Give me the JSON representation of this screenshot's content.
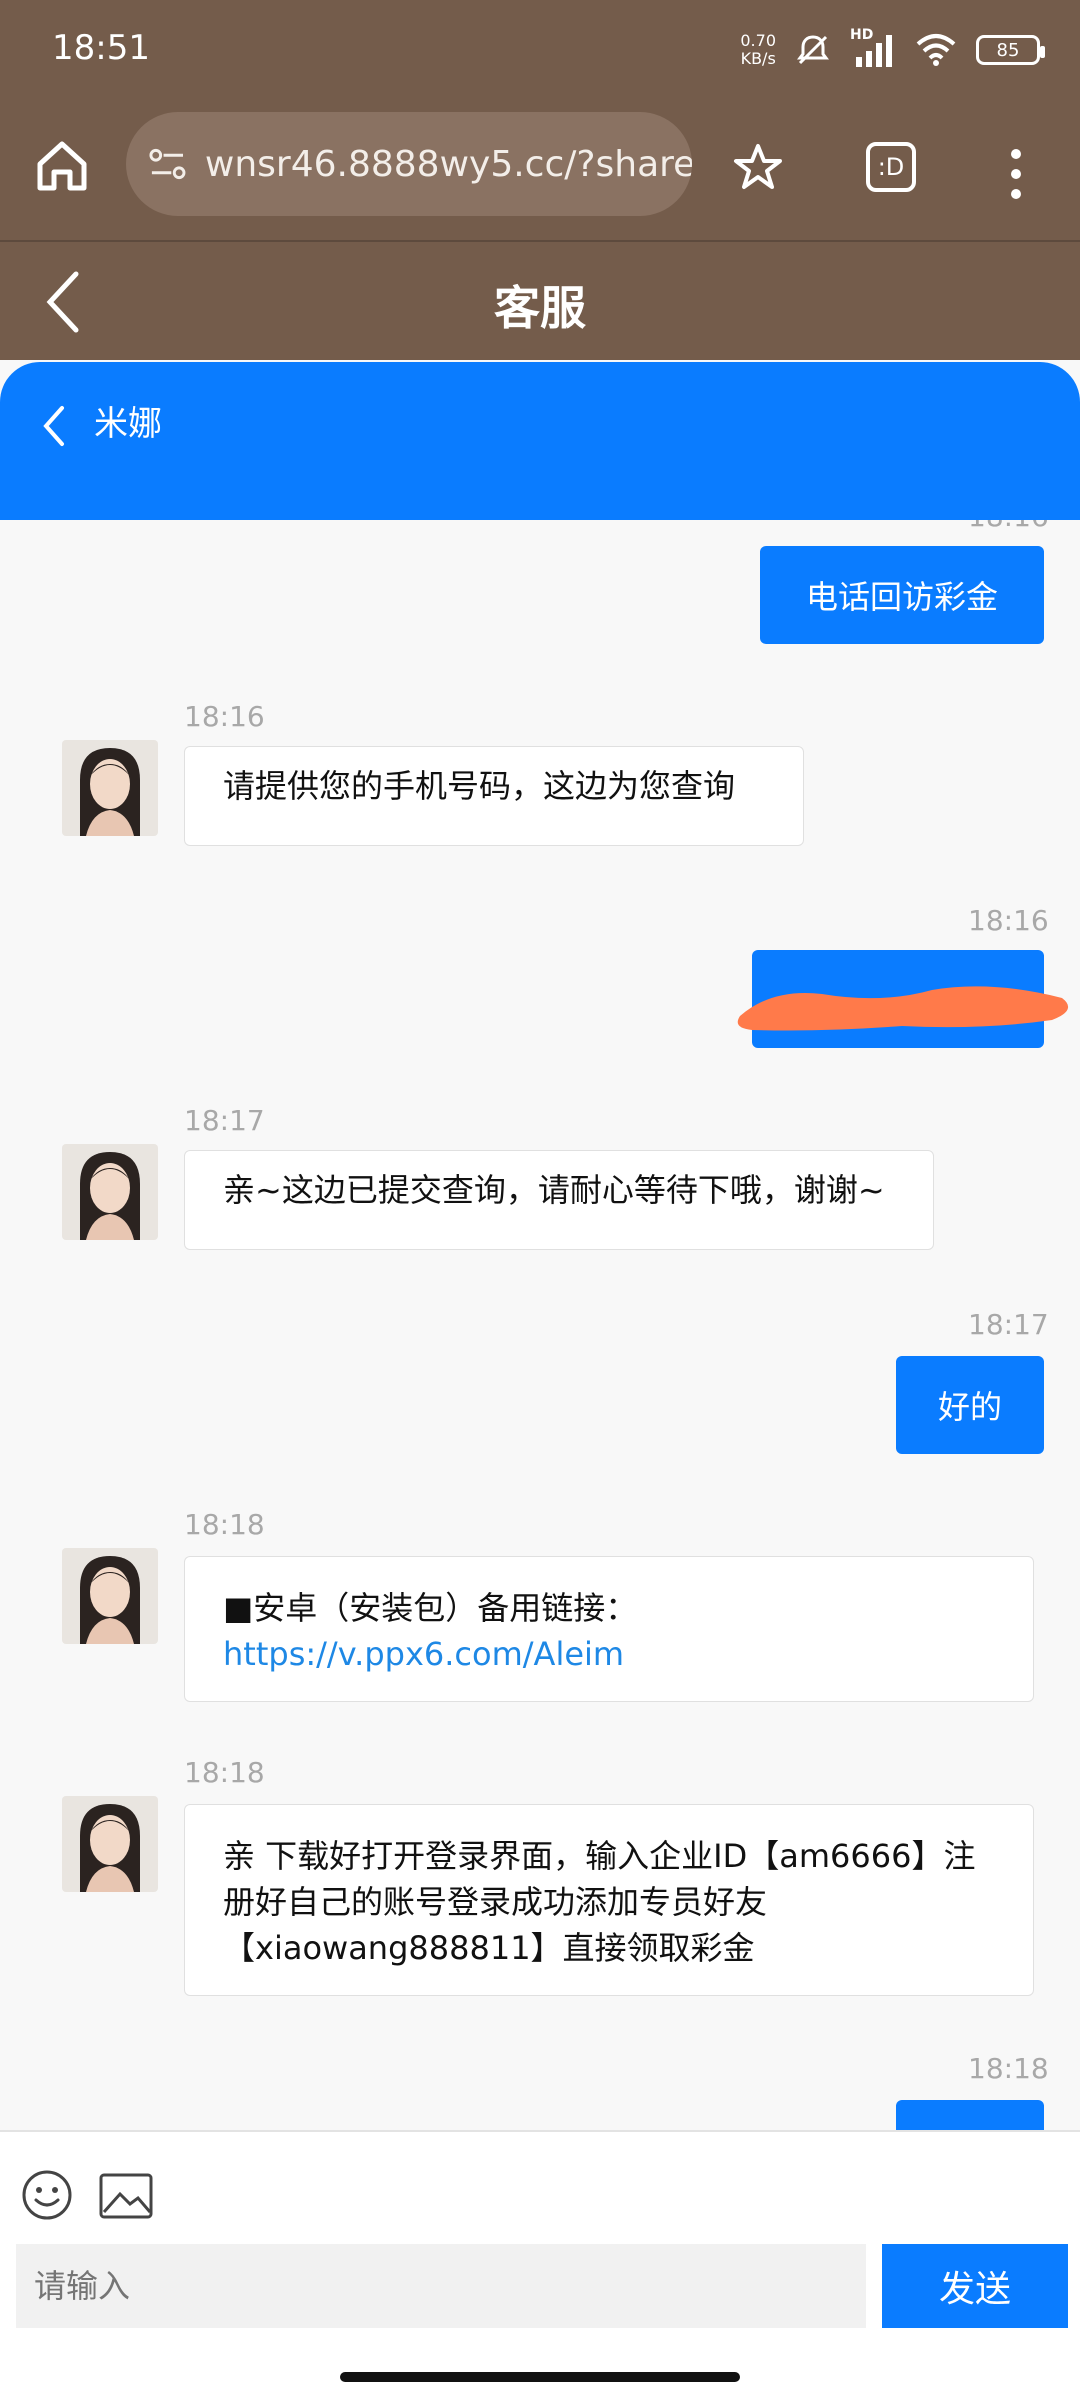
{
  "status": {
    "time": "18:51",
    "net_speed_value": "0.70",
    "net_speed_unit": "KB/s",
    "signal_label": "HD",
    "battery": "85"
  },
  "browser": {
    "url": "wnsr46.8888wy5.cc/?shareI",
    "tab_label": ":D"
  },
  "page": {
    "title": "客服"
  },
  "chat": {
    "name": "米娜",
    "messages": [
      {
        "side": "right",
        "time": "18:16",
        "text": "电话回访彩金"
      },
      {
        "side": "left",
        "time": "18:16",
        "text": "请提供您的手机号码，这边为您查询"
      },
      {
        "side": "right",
        "time": "18:16",
        "text": "",
        "redacted": true
      },
      {
        "side": "left",
        "time": "18:17",
        "text": "亲~这边已提交查询，请耐心等待下哦，谢谢~"
      },
      {
        "side": "right",
        "time": "18:17",
        "text": "好的"
      },
      {
        "side": "left",
        "time": "18:18",
        "line1": "■安卓（安装包）备用链接：",
        "link": "https://v.ppx6.com/Aleim"
      },
      {
        "side": "left",
        "time": "18:18",
        "line1": "亲 下载好打开登录界面，输入企业ID【am6666】注",
        "line2": "册好自己的账号登录成功添加专员好友",
        "line3": "【xiaowang888811】直接领取彩金"
      },
      {
        "side": "right",
        "time": "18:18",
        "text": ""
      }
    ]
  },
  "input": {
    "placeholder": "请输入",
    "send_label": "发送"
  },
  "colors": {
    "browser_bg": "#745c4b",
    "accent": "#0a7cff",
    "redaction": "#ff7a4a"
  },
  "icons": [
    "home-icon",
    "site-settings-icon",
    "star-icon",
    "more-icon",
    "back-icon",
    "chevron-left-icon",
    "emoji-icon",
    "image-icon"
  ]
}
